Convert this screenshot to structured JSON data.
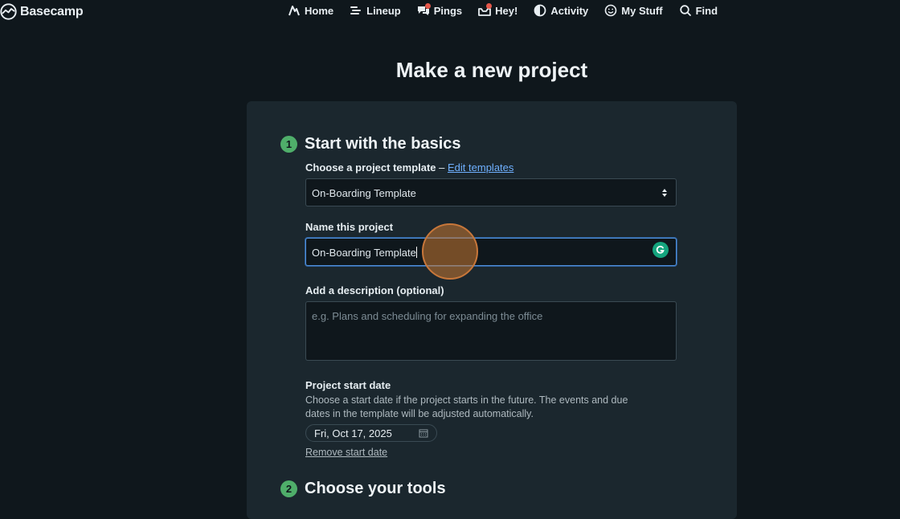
{
  "app": {
    "name": "Basecamp"
  },
  "nav": [
    {
      "label": "Home",
      "icon": "home-icon"
    },
    {
      "label": "Lineup",
      "icon": "lineup-icon"
    },
    {
      "label": "Pings",
      "icon": "pings-icon",
      "badge": true
    },
    {
      "label": "Hey!",
      "icon": "hey-icon",
      "badge": true
    },
    {
      "label": "Activity",
      "icon": "activity-icon"
    },
    {
      "label": "My Stuff",
      "icon": "smiley-icon"
    },
    {
      "label": "Find",
      "icon": "search-icon"
    }
  ],
  "page": {
    "title": "Make a new project"
  },
  "step1": {
    "number": "1",
    "title": "Start with the basics",
    "template_label": "Choose a project template",
    "template_sep": " – ",
    "edit_templates": "Edit templates",
    "template_value": "On-Boarding Template",
    "name_label": "Name this project",
    "name_value": "On-Boarding Template",
    "desc_label": "Add a description (optional)",
    "desc_placeholder": "e.g. Plans and scheduling for expanding the office",
    "start_label": "Project start date",
    "start_help": "Choose a start date if the project starts in the future. The events and due dates in the template will be adjusted automatically.",
    "start_value": "Fri, Oct 17, 2025",
    "remove_start": "Remove start date"
  },
  "step2": {
    "number": "2",
    "title": "Choose your tools"
  },
  "colors": {
    "accent_green": "#4fae6a",
    "link": "#6fb0ff",
    "focus": "#4f8fd9",
    "grammarly": "#15a57e"
  }
}
